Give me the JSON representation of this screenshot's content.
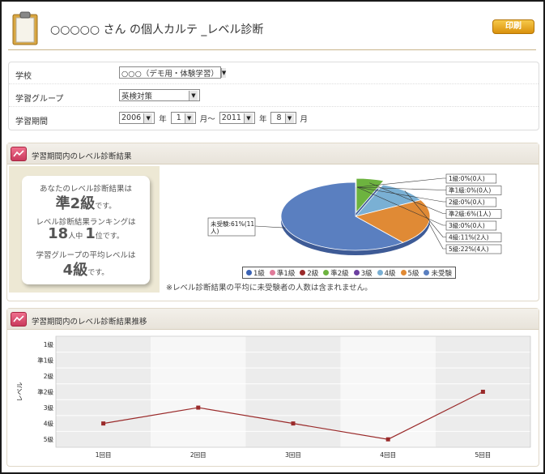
{
  "header": {
    "title": "○○○○○ さん の個人カルテ _レベル診断",
    "print_label": "印刷"
  },
  "form": {
    "school": {
      "label": "学校",
      "value": "○○○（デモ用・体験学習）"
    },
    "group": {
      "label": "学習グループ",
      "value": "英検対策"
    },
    "period": {
      "label": "学習期間",
      "from_year": "2006",
      "year_unit": "年",
      "from_month": "1",
      "month_unit": "月～",
      "to_year": "2011",
      "to_year_unit": "年",
      "to_month": "8",
      "to_month_unit": "月"
    }
  },
  "results_panel": {
    "title": "学習期間内のレベル診断結果",
    "line1": "あなたのレベル診断結果は",
    "level": "準2級",
    "level_suffix": "です。",
    "line3": "レベル診断結果ランキングは",
    "rank_total": "18",
    "rank_mid": "人中",
    "rank": "1",
    "rank_suffix": "位です。",
    "line5": "学習グループの平均レベルは",
    "avg_level": "4級",
    "avg_suffix": "です。",
    "note": "※レベル診断結果の平均に未受験者の人数は含まれません。"
  },
  "trend_panel": {
    "title": "学習期間内のレベル診断結果推移"
  },
  "chart_data": [
    {
      "type": "pie",
      "slices": [
        {
          "label": "1級",
          "callout": "1級:0%(0人)",
          "percent": 0,
          "count": 0,
          "color": "#3b63b5"
        },
        {
          "label": "準1級",
          "callout": "準1級:0%(0人)",
          "percent": 0,
          "count": 0,
          "color": "#e07b9a"
        },
        {
          "label": "2級",
          "callout": "2級:0%(0人)",
          "percent": 0,
          "count": 0,
          "color": "#9a2a2a"
        },
        {
          "label": "準2級",
          "callout": "準2級:6%(1人)",
          "percent": 6,
          "count": 1,
          "color": "#6db33f"
        },
        {
          "label": "3級",
          "callout": "3級:0%(0人)",
          "percent": 0,
          "count": 0,
          "color": "#6b3fa0"
        },
        {
          "label": "4級",
          "callout": "4級:11%(2人)",
          "percent": 11,
          "count": 2,
          "color": "#7ab0d4"
        },
        {
          "label": "5級",
          "callout": "5級:22%(4人)",
          "percent": 22,
          "count": 4,
          "color": "#e08a35"
        },
        {
          "label": "未受験",
          "callout": "未受験:61%(11人)",
          "percent": 61,
          "count": 11,
          "color": "#5a7fc0"
        }
      ],
      "legend": [
        "1級",
        "準1級",
        "2級",
        "準2級",
        "3級",
        "4級",
        "5級",
        "未受験"
      ]
    },
    {
      "type": "line",
      "ylabel": "レベル",
      "y_categories": [
        "1級",
        "準1級",
        "2級",
        "準2級",
        "3級",
        "4級",
        "5級"
      ],
      "x": [
        "1回目",
        "2回目",
        "3回目",
        "4回目",
        "5回目"
      ],
      "values": [
        "4級",
        "3級",
        "4級",
        "5級",
        "準2級"
      ],
      "color": "#9a2a2a"
    }
  ]
}
